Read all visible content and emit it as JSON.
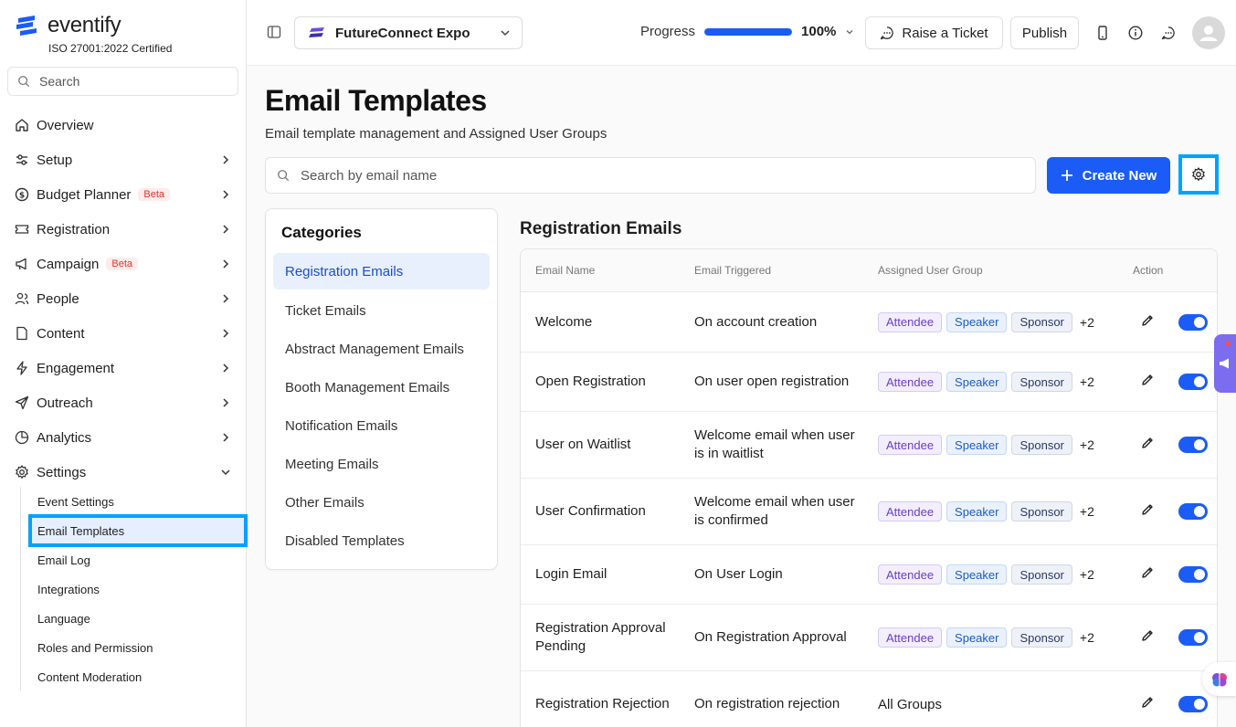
{
  "brand": {
    "name": "eventify",
    "certification": "ISO 27001:2022 Certified",
    "accent": "#1a5cf5"
  },
  "sidebar": {
    "search_placeholder": "Search",
    "items": [
      {
        "label": "Overview",
        "icon": "home-icon",
        "has_chevron": false
      },
      {
        "label": "Setup",
        "icon": "sliders-icon",
        "has_chevron": true
      },
      {
        "label": "Budget Planner",
        "icon": "dollar-icon",
        "badge": "Beta",
        "has_chevron": true
      },
      {
        "label": "Registration",
        "icon": "ticket-icon",
        "has_chevron": true
      },
      {
        "label": "Campaign",
        "icon": "megaphone-icon",
        "badge": "Beta",
        "has_chevron": true
      },
      {
        "label": "People",
        "icon": "users-icon",
        "has_chevron": true
      },
      {
        "label": "Content",
        "icon": "file-icon",
        "has_chevron": true
      },
      {
        "label": "Engagement",
        "icon": "bolt-icon",
        "has_chevron": true
      },
      {
        "label": "Outreach",
        "icon": "send-icon",
        "has_chevron": true
      },
      {
        "label": "Analytics",
        "icon": "pie-chart-icon",
        "has_chevron": true
      },
      {
        "label": "Settings",
        "icon": "gear-icon",
        "has_chevron": true,
        "expanded": true
      }
    ],
    "settings_subitems": [
      {
        "label": "Event Settings"
      },
      {
        "label": "Email Templates",
        "active": true
      },
      {
        "label": "Email Log"
      },
      {
        "label": "Integrations"
      },
      {
        "label": "Language"
      },
      {
        "label": "Roles and Permission"
      },
      {
        "label": "Content Moderation"
      }
    ]
  },
  "topbar": {
    "event_name": "FutureConnect Expo",
    "progress_label": "Progress",
    "progress_value": "100%",
    "progress_fraction": 1.0,
    "raise_ticket_label": "Raise a Ticket",
    "publish_label": "Publish"
  },
  "main": {
    "title": "Email Templates",
    "subtitle": "Email template management and Assigned User Groups",
    "search_placeholder": "Search by email name",
    "create_label": "Create New",
    "categories_title": "Categories",
    "categories": [
      {
        "label": "Registration Emails",
        "active": true
      },
      {
        "label": "Ticket Emails"
      },
      {
        "label": "Abstract Management Emails"
      },
      {
        "label": "Booth Management Emails"
      },
      {
        "label": "Notification Emails"
      },
      {
        "label": "Meeting Emails"
      },
      {
        "label": "Other Emails"
      },
      {
        "label": "Disabled Templates"
      }
    ],
    "section_title": "Registration Emails",
    "table": {
      "columns": [
        "Email Name",
        "Email Triggered",
        "Assigned User Group",
        "Action"
      ],
      "rows": [
        {
          "name": "Welcome",
          "trigger": "On account creation",
          "groups": [
            "Attendee",
            "Speaker",
            "Sponsor"
          ],
          "more": "+2",
          "enabled": true
        },
        {
          "name": "Open Registration",
          "trigger": "On user open registration",
          "groups": [
            "Attendee",
            "Speaker",
            "Sponsor"
          ],
          "more": "+2",
          "enabled": true
        },
        {
          "name": "User on Waitlist",
          "trigger": "Welcome email when user is in waitlist",
          "groups": [
            "Attendee",
            "Speaker",
            "Sponsor"
          ],
          "more": "+2",
          "enabled": true
        },
        {
          "name": "User Confirmation",
          "trigger": "Welcome email when user is confirmed",
          "groups": [
            "Attendee",
            "Speaker",
            "Sponsor"
          ],
          "more": "+2",
          "enabled": true
        },
        {
          "name": "Login Email",
          "trigger": "On User Login",
          "groups": [
            "Attendee",
            "Speaker",
            "Sponsor"
          ],
          "more": "+2",
          "enabled": true
        },
        {
          "name": "Registration Approval Pending",
          "trigger": "On Registration Approval",
          "groups": [
            "Attendee",
            "Speaker",
            "Sponsor"
          ],
          "more": "+2",
          "enabled": true
        },
        {
          "name": "Registration Rejection",
          "trigger": "On registration rejection",
          "groups_text": "All Groups",
          "enabled": true
        }
      ]
    }
  }
}
